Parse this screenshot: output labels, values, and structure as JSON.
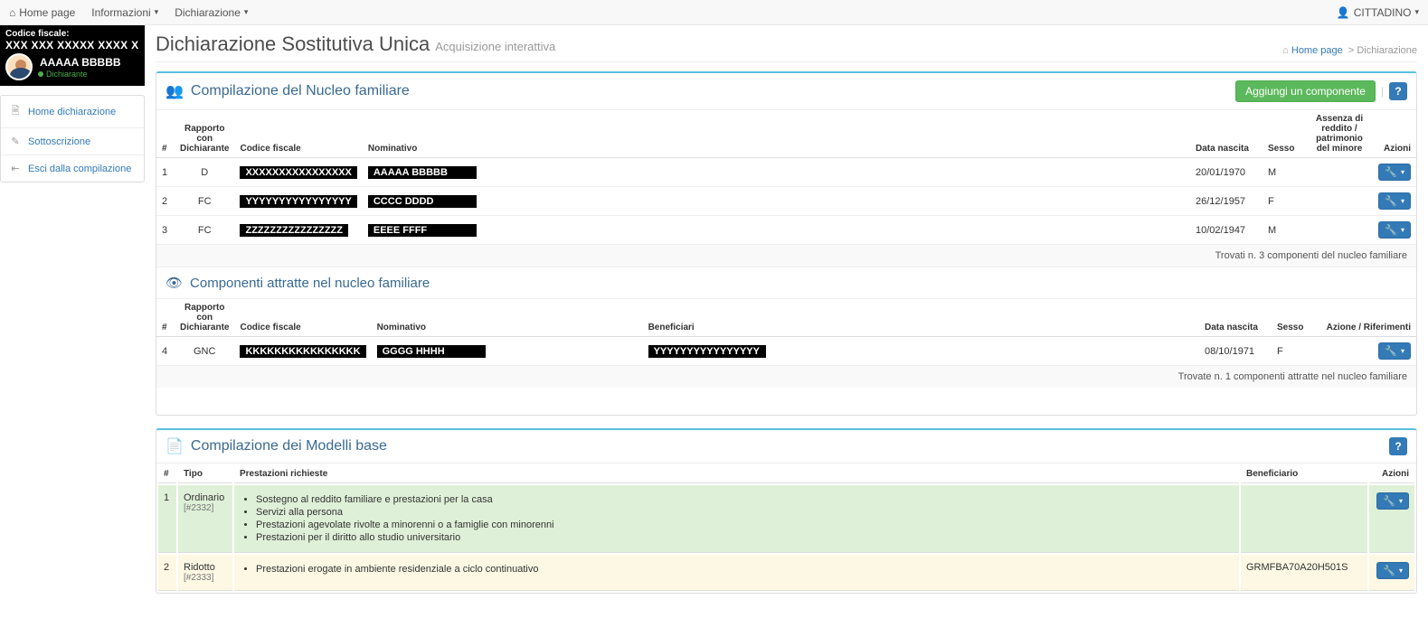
{
  "topnav": {
    "home": "Home page",
    "info": "Informazioni",
    "dich": "Dichiarazione",
    "user": "CITTADINO"
  },
  "sidebar": {
    "cf_label": "Codice fiscale:",
    "cf": "XXX XXX XXXXX XXXX X",
    "name": "AAAAA BBBBB",
    "role": "Dichiarante",
    "menu": {
      "home_decl": "Home dichiarazione",
      "sub": "Sottoscrizione",
      "exit": "Esci dalla compilazione"
    }
  },
  "header": {
    "title": "Dichiarazione Sostitutiva Unica",
    "subtitle": "Acquisizione interattiva"
  },
  "breadcrumb": {
    "home": "Home page",
    "current": "Dichiarazione"
  },
  "nucleo": {
    "title": "Compilazione del Nucleo familiare",
    "add_btn": "Aggiungi un componente",
    "cols": {
      "idx": "#",
      "rapporto": "Rapporto con Dichiarante",
      "cf": "Codice fiscale",
      "nome": "Nominativo",
      "nascita": "Data nascita",
      "sesso": "Sesso",
      "assenza": "Assenza di reddito / patrimonio del minore",
      "azioni": "Azioni"
    },
    "rows": [
      {
        "idx": "1",
        "rap": "D",
        "cf": "XXXXXXXXXXXXXXXX",
        "nome": "AAAAA BBBBB",
        "nascita": "20/01/1970",
        "sesso": "M"
      },
      {
        "idx": "2",
        "rap": "FC",
        "cf": "YYYYYYYYYYYYYYYY",
        "nome": "CCCC DDDD",
        "nascita": "26/12/1957",
        "sesso": "F"
      },
      {
        "idx": "3",
        "rap": "FC",
        "cf": "ZZZZZZZZZZZZZZZZ",
        "nome": "EEEE FFFF",
        "nascita": "10/02/1947",
        "sesso": "M"
      }
    ],
    "footer": "Trovati n. 3 componenti del nucleo familiare"
  },
  "attratte": {
    "title": "Componenti attratte nel nucleo familiare",
    "cols": {
      "idx": "#",
      "rapporto": "Rapporto con Dichiarante",
      "cf": "Codice fiscale",
      "nome": "Nominativo",
      "benef": "Beneficiari",
      "nascita": "Data nascita",
      "sesso": "Sesso",
      "azioni": "Azione / Riferimenti"
    },
    "rows": [
      {
        "idx": "4",
        "rap": "GNC",
        "cf": "KKKKKKKKKKKKKKKK",
        "nome": "GGGG HHHH",
        "benef": "YYYYYYYYYYYYYYYY",
        "nascita": "08/10/1971",
        "sesso": "F"
      }
    ],
    "footer": "Trovate n. 1 componenti attratte nel nucleo familiare"
  },
  "modelli": {
    "title": "Compilazione dei Modelli base",
    "cols": {
      "idx": "#",
      "tipo": "Tipo",
      "prest": "Prestazioni richieste",
      "benef": "Beneficiario",
      "azioni": "Azioni"
    },
    "rows": [
      {
        "idx": "1",
        "tipo": "Ordinario",
        "code": "[#2332]",
        "benef": "",
        "items": [
          "Sostegno al reddito familiare e prestazioni per la casa",
          "Servizi alla persona",
          "Prestazioni agevolate rivolte a minorenni o a famiglie con minorenni",
          "Prestazioni per il diritto allo studio universitario"
        ]
      },
      {
        "idx": "2",
        "tipo": "Ridotto",
        "code": "[#2333]",
        "benef": "GRMFBA70A20H501S",
        "items": [
          "Prestazioni erogate in ambiente residenziale a ciclo continuativo"
        ]
      }
    ]
  }
}
